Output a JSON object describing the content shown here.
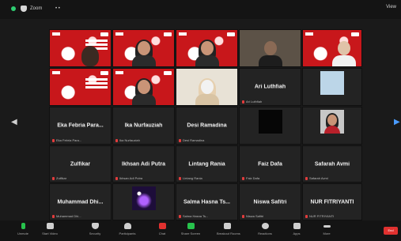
{
  "topbar": {
    "title": "Zoom",
    "view_label": "View"
  },
  "participants": [
    {
      "name": "",
      "footer": ""
    },
    {
      "name": "",
      "footer": ""
    },
    {
      "name": "",
      "footer": ""
    },
    {
      "name": "",
      "footer": ""
    },
    {
      "name": "",
      "footer": ""
    },
    {
      "name": "",
      "footer": ""
    },
    {
      "name": "",
      "footer": ""
    },
    {
      "name": "",
      "footer": ""
    },
    {
      "name": "Ari Luthfiah",
      "footer": "Ari Luthfiah"
    },
    {
      "name": "",
      "footer": ""
    },
    {
      "name": "Eka Febria Para...",
      "footer": "Eka Febria Para..."
    },
    {
      "name": "Ika Nurfauziah",
      "footer": "Ika Nurfauziah"
    },
    {
      "name": "Desi Ramadina",
      "footer": "Desi Ramadina"
    },
    {
      "name": "",
      "footer": ""
    },
    {
      "name": "",
      "footer": ""
    },
    {
      "name": "Zulfikar",
      "footer": "Zulfikar"
    },
    {
      "name": "Ikhsan Adi Putra",
      "footer": "Ikhsan Adi Putra"
    },
    {
      "name": "Lintang Rania",
      "footer": "Lintang Rania"
    },
    {
      "name": "Faiz Dafa",
      "footer": "Faiz Dafa"
    },
    {
      "name": "Safarah Avmi",
      "footer": "Safarah Avmi"
    },
    {
      "name": "Muhammad Dhi...",
      "footer": "Muhammad Dhi..."
    },
    {
      "name": "",
      "footer": ""
    },
    {
      "name": "Salma Hasna Ts...",
      "footer": "Salma Hasna Ts..."
    },
    {
      "name": "Niswa Safitri",
      "footer": "Niswa Safitri"
    },
    {
      "name": "NUR FITRIYANTI",
      "footer": "NUR FITRIYANTI"
    }
  ],
  "toolbar": {
    "items": [
      "Unmute",
      "Start Video",
      "Security",
      "Participants",
      "Chat",
      "Share Screen",
      "Breakout Rooms",
      "Reactions",
      "Apps",
      "More"
    ],
    "end_label": "End"
  }
}
